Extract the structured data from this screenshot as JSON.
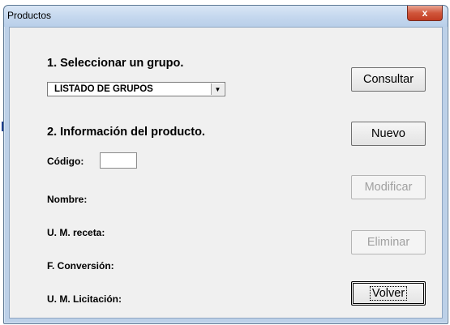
{
  "window": {
    "title": "Productos",
    "close_glyph": "x"
  },
  "section1": {
    "heading": "1. Seleccionar un grupo.",
    "group_select": {
      "selected": "LISTADO DE GRUPOS"
    }
  },
  "section2": {
    "heading": "2. Información del producto.",
    "fields": {
      "codigo": "Código:",
      "nombre": "Nombre:",
      "um_receta": "U. M. receta:",
      "conversion": "F. Conversión:",
      "um_licitacion": "U. M. Licitación:"
    },
    "codigo_value": ""
  },
  "buttons": {
    "consultar": "Consultar",
    "nuevo": "Nuevo",
    "modificar": "Modificar",
    "eliminar": "Eliminar",
    "volver": "Volver"
  },
  "icons": {
    "close": "close-icon",
    "dropdown": "chevron-down-icon"
  }
}
